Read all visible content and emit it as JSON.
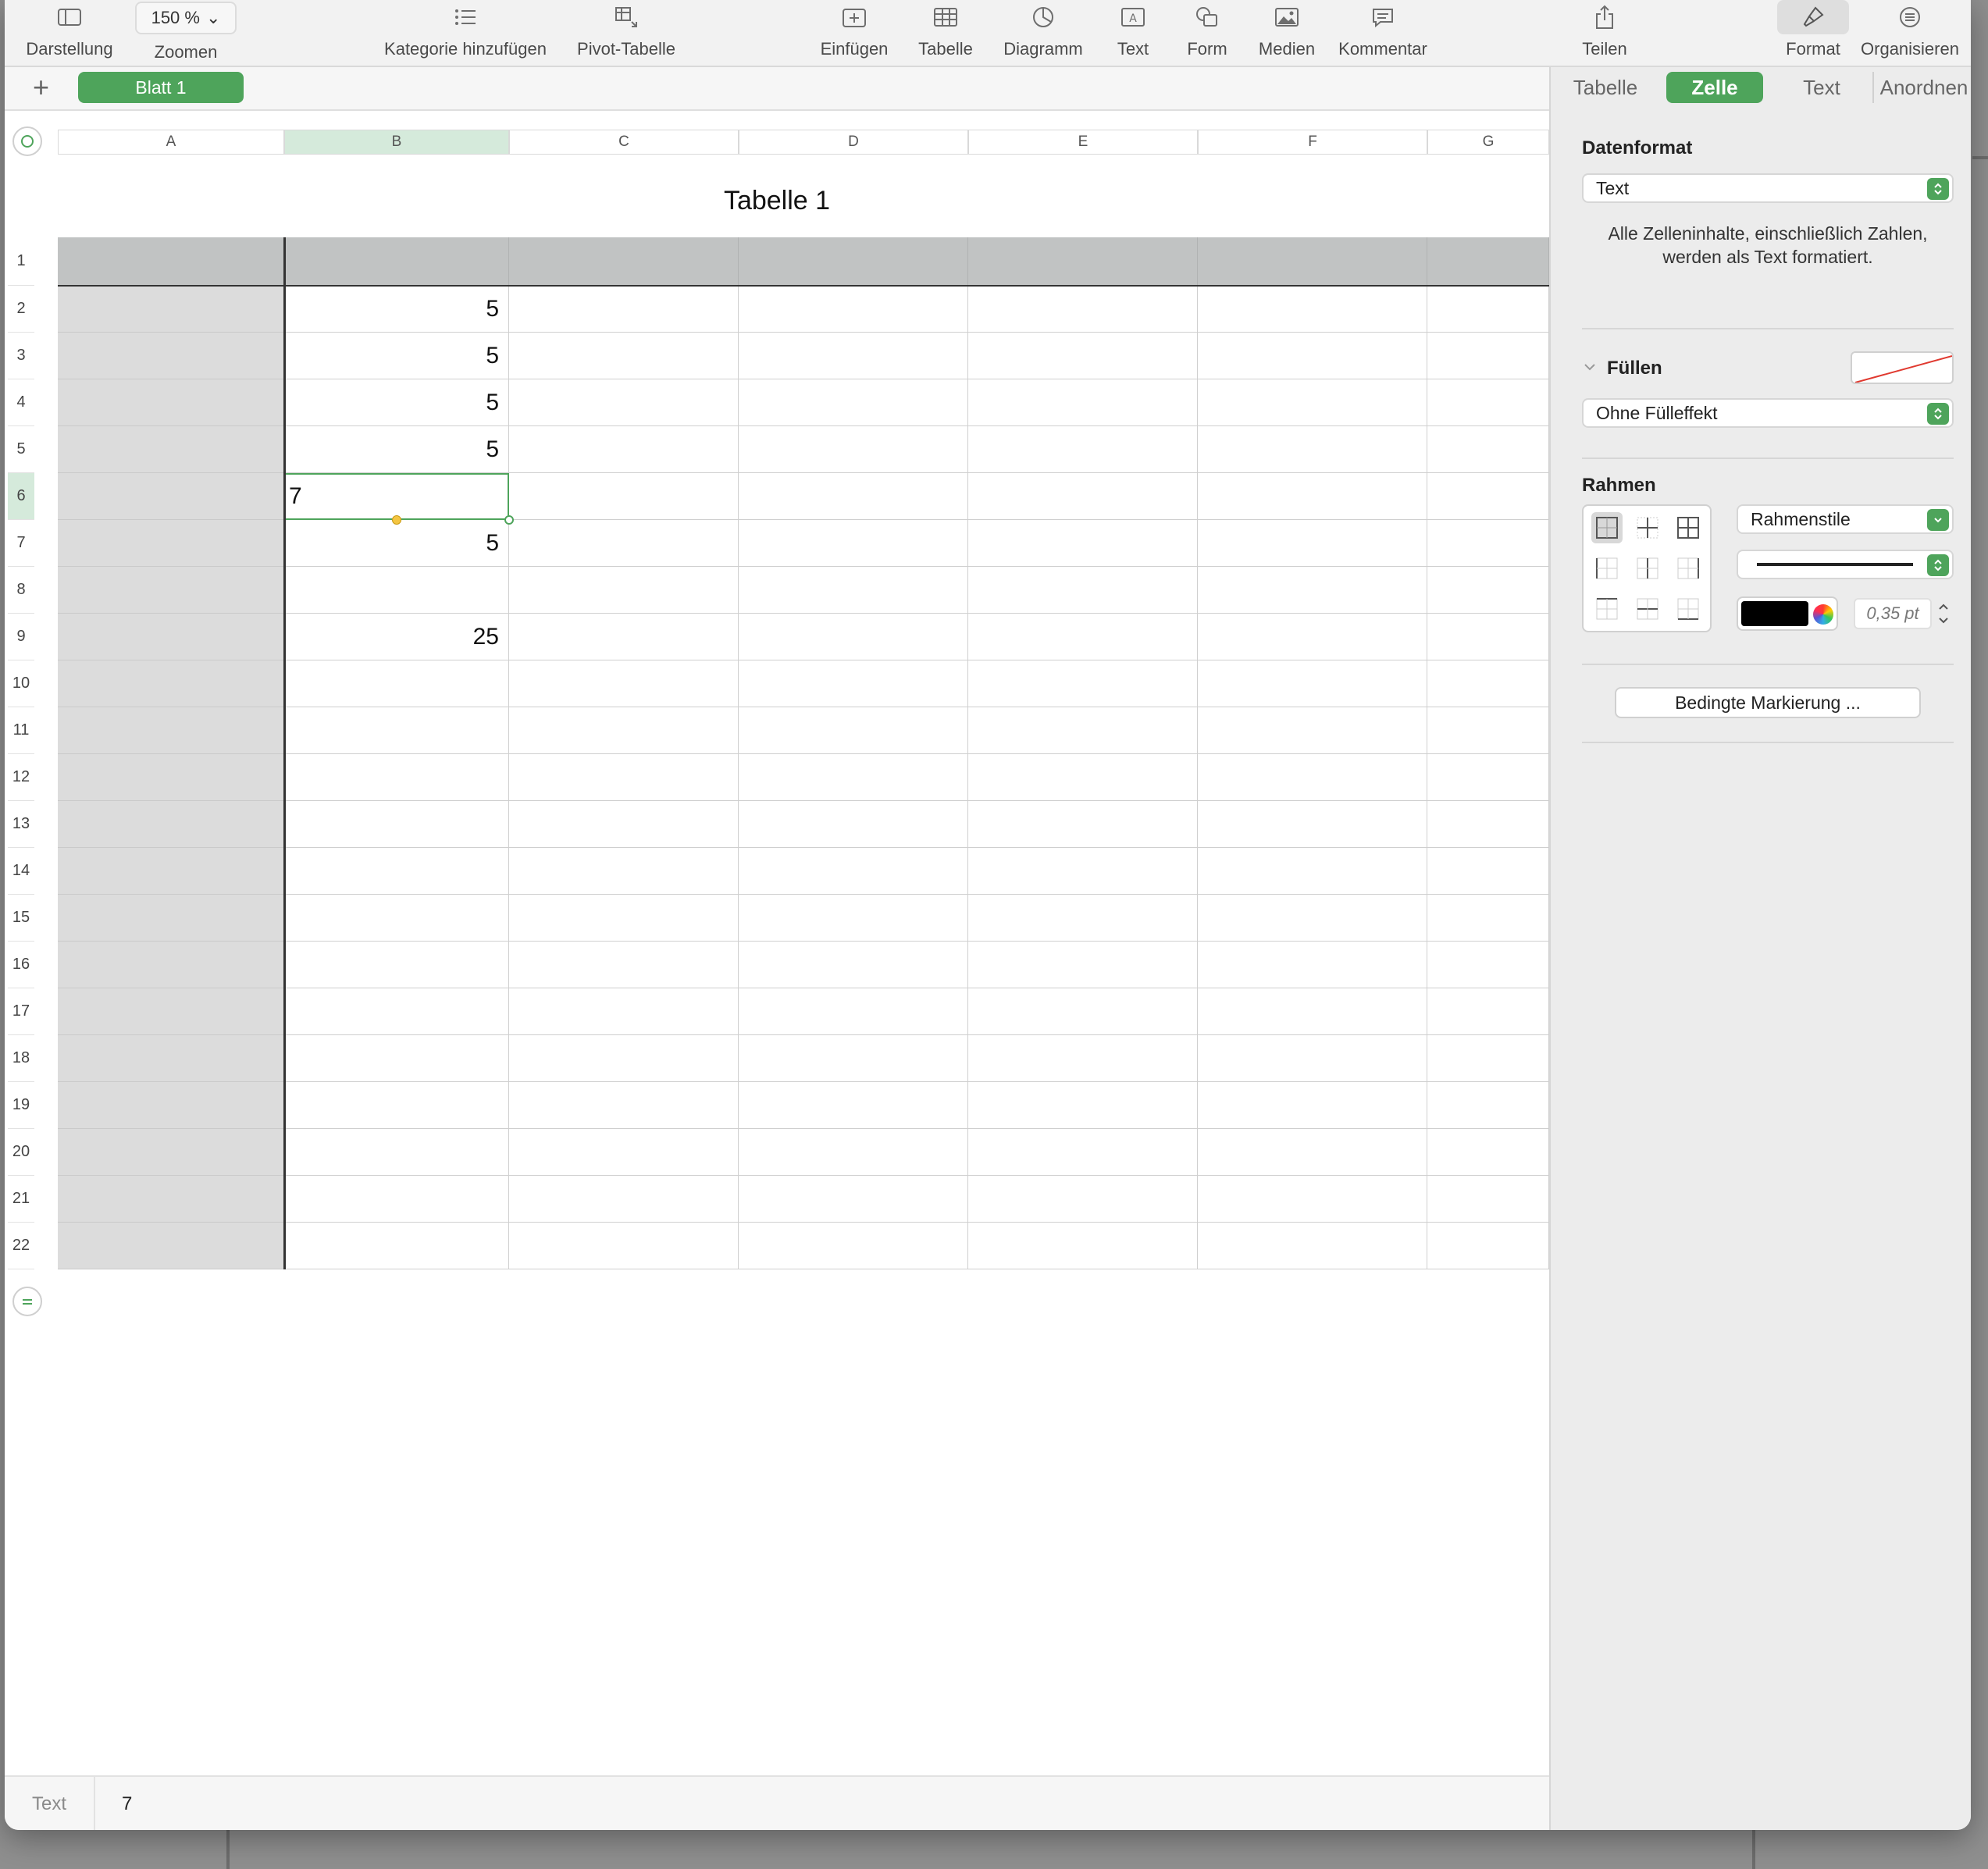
{
  "toolbar": {
    "view_label": "Darstellung",
    "zoom_value": "150 %",
    "zoom_label": "Zoomen",
    "category_label": "Kategorie hinzufügen",
    "pivot_label": "Pivot-Tabelle",
    "insert_label": "Einfügen",
    "table_label": "Tabelle",
    "chart_label": "Diagramm",
    "text_label": "Text",
    "shape_label": "Form",
    "media_label": "Medien",
    "comment_label": "Kommentar",
    "share_label": "Teilen",
    "format_label": "Format",
    "organize_label": "Organisieren"
  },
  "sheets": {
    "add": "+",
    "active": "Blatt 1"
  },
  "sidebar": {
    "tabs": [
      "Tabelle",
      "Zelle",
      "Text",
      "Anordnen"
    ],
    "selected_tab": "Zelle",
    "data_format_title": "Datenformat",
    "data_format_value": "Text",
    "data_format_desc_line1": "Alle Zelleninhalte, einschließlich Zahlen,",
    "data_format_desc_line2": "werden als Text formatiert.",
    "fill_title": "Füllen",
    "fill_value": "Ohne Fülleffekt",
    "border_title": "Rahmen",
    "border_style": "Rahmenstile",
    "border_width": "0,35 pt",
    "conditional_button": "Bedingte Markierung ...",
    "accent_color": "#4ea45b"
  },
  "table": {
    "title": "Tabelle 1",
    "columns": [
      "A",
      "B",
      "C",
      "D",
      "E",
      "F",
      "G"
    ],
    "rows": [
      "1",
      "2",
      "3",
      "4",
      "5",
      "6",
      "7",
      "8",
      "9",
      "10",
      "11",
      "12",
      "13",
      "14",
      "15",
      "16",
      "17",
      "18",
      "19",
      "20",
      "21",
      "22"
    ],
    "b_values": [
      "",
      "5",
      "5",
      "5",
      "5",
      "7",
      "5",
      "",
      "25",
      "",
      "",
      "",
      "",
      "",
      "",
      "",
      "",
      "",
      "",
      "",
      "",
      ""
    ],
    "selected_cell": "B6"
  },
  "footer": {
    "format": "Text",
    "value": "7"
  }
}
